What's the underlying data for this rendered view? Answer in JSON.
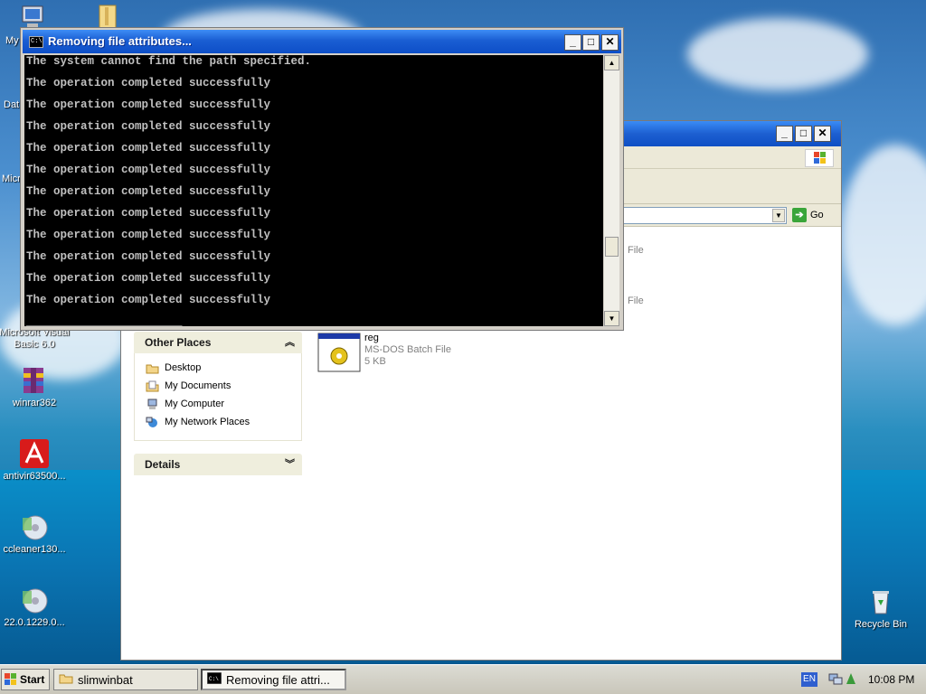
{
  "desktop": {
    "icons_left": [
      {
        "label": "My",
        "icon": "my-computer-icon"
      },
      {
        "label": "Dat",
        "icon": "folder-icon"
      },
      {
        "label": "Micro",
        "icon": "app-icon"
      },
      {
        "label": "Microsoft Visual Basic 6.0",
        "icon": "visual-basic-icon"
      },
      {
        "label": "winrar362",
        "icon": "winrar-icon"
      },
      {
        "label": "antivir63500...",
        "icon": "antivir-icon"
      },
      {
        "label": "ccleaner130...",
        "icon": "ccleaner-icon"
      },
      {
        "label": "22.0.1229.0...",
        "icon": "installer-icon"
      }
    ],
    "recycle_bin": {
      "label": "Recycle Bin"
    }
  },
  "explorer": {
    "address_go": "Go",
    "other_places": {
      "title": "Other Places",
      "items": [
        {
          "label": "Desktop",
          "icon": "desktop-folder-icon"
        },
        {
          "label": "My Documents",
          "icon": "my-documents-icon"
        },
        {
          "label": "My Computer",
          "icon": "my-computer-icon"
        },
        {
          "label": "My Network Places",
          "icon": "network-places-icon"
        }
      ]
    },
    "details": {
      "title": "Details"
    },
    "files": [
      {
        "name": "",
        "type": "File",
        "size": ""
      },
      {
        "name": "",
        "type": "File",
        "size": ""
      },
      {
        "name": "reg",
        "type": "MS-DOS Batch File",
        "size": "5 KB"
      }
    ]
  },
  "console": {
    "title": "Removing file attributes...",
    "icon_text": "C:\\",
    "lines": [
      "The system cannot find the path specified.",
      "The operation completed successfully",
      "The operation completed successfully",
      "The operation completed successfully",
      "The operation completed successfully",
      "The operation completed successfully",
      "The operation completed successfully",
      "The operation completed successfully",
      "The operation completed successfully",
      "The operation completed successfully",
      "The operation completed successfully",
      "The operation completed successfully",
      "_______________________"
    ]
  },
  "taskbar": {
    "start_label": "Start",
    "tasks": [
      {
        "label": "slimwinbat",
        "icon": "folder-icon"
      },
      {
        "label": "Removing file attri...",
        "icon": "console-icon"
      }
    ],
    "language": "EN",
    "clock": "10:08 PM"
  },
  "colors": {
    "title_blue": "#1d5fd1",
    "console_bg": "#000000",
    "console_text": "#c0c0c0",
    "taskbar": "#d4d0c8"
  }
}
